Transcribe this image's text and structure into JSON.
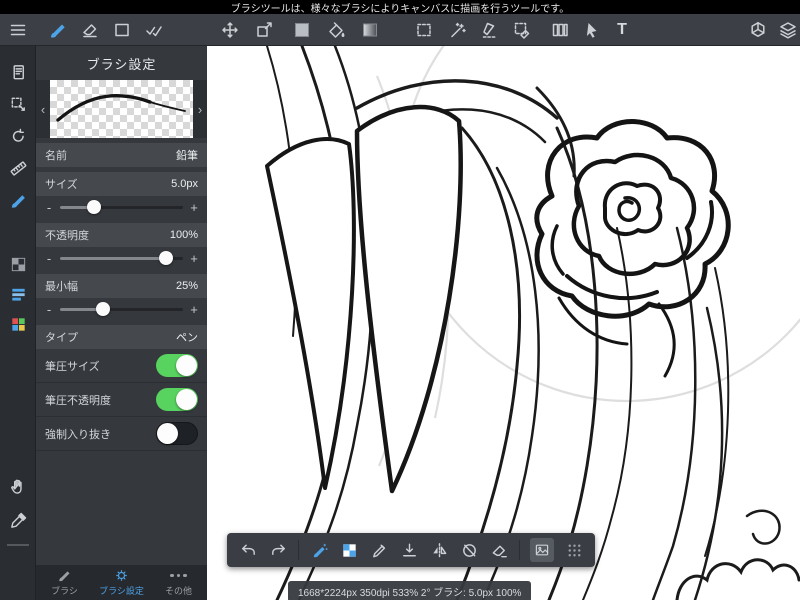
{
  "topbar": {
    "tooltip": "ブラシツールは、様々なブラシによりキャンバスに描画を行うツールです。"
  },
  "toolbar": {
    "icons": [
      "menu",
      "brush",
      "eraser",
      "marquee",
      "multi-select",
      "move",
      "transform",
      "color-swatch",
      "bucket",
      "gradient",
      "select-lasso",
      "magic-wand",
      "pen-select",
      "erase-select",
      "snap-settings",
      "cursor",
      "text",
      "materials",
      "layers"
    ],
    "text_label": "T"
  },
  "rail": {
    "icons": [
      "pages",
      "select",
      "rotate-canvas",
      "ruler",
      "draw",
      "transparent-background",
      "layers-panel",
      "palette",
      "hand",
      "eyedropper"
    ],
    "active": "draw"
  },
  "panel": {
    "title": "ブラシ設定",
    "preview": {
      "prev": "‹",
      "next": "›"
    },
    "slider": {
      "minus": "-",
      "plus": "+"
    },
    "fields": {
      "name": {
        "label": "名前",
        "value": "鉛筆"
      },
      "size": {
        "label": "サイズ",
        "value": "5.0px",
        "pos": "--p:28%"
      },
      "opacity": {
        "label": "不透明度",
        "value": "100%",
        "pos": "--p:86%"
      },
      "min_width": {
        "label": "最小幅",
        "value": "25%",
        "pos": "--p:35%"
      },
      "type": {
        "label": "タイプ",
        "value": "ペン"
      }
    },
    "toggles": [
      {
        "label": "筆圧サイズ",
        "state": "on"
      },
      {
        "label": "筆圧不透明度",
        "state": "on"
      },
      {
        "label": "強制入り抜き",
        "state": "off"
      }
    ]
  },
  "tabs": [
    {
      "label": "ブラシ",
      "active": false
    },
    {
      "label": "ブラシ設定",
      "active": true
    },
    {
      "label": "その他",
      "active": false
    }
  ],
  "floating_toolbar": {
    "icons": [
      "undo",
      "redo",
      "smart-brush",
      "transparent-bg",
      "pen",
      "save",
      "flip-horizontal",
      "rotate-reset",
      "clear",
      "image",
      "drag-handle"
    ]
  },
  "status": {
    "text": "1668*2224px 350dpi 533% 2° ブラシ: 5.0px 100%"
  },
  "colors": {
    "accent": "#4da3e8",
    "toggle_on": "#58d35f",
    "canvas_bg": "#ffffff"
  }
}
